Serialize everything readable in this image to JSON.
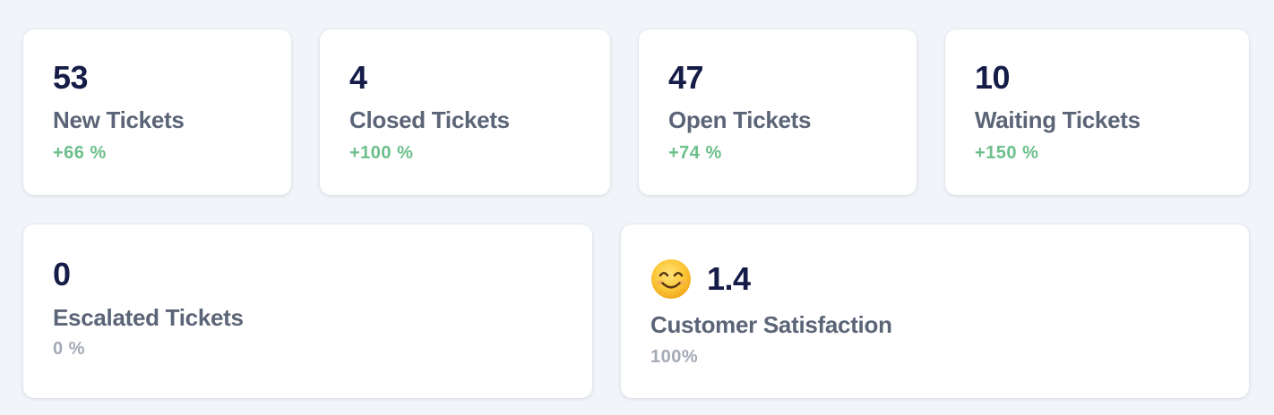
{
  "colors": {
    "background": "#f1f4f8",
    "card": "#ffffff",
    "value_text": "#141c47",
    "label_text": "#5b6577",
    "positive_change": "#6cbf8a",
    "neutral_change": "#a3aab6"
  },
  "stats": {
    "new": {
      "value": "53",
      "label": "New Tickets",
      "change": "+66 %"
    },
    "closed": {
      "value": "4",
      "label": "Closed Tickets",
      "change": "+100 %"
    },
    "open": {
      "value": "47",
      "label": "Open Tickets",
      "change": "+74 %"
    },
    "waiting": {
      "value": "10",
      "label": "Waiting Tickets",
      "change": "+150 %"
    },
    "escalated": {
      "value": "0",
      "label": "Escalated Tickets",
      "change": "0 %"
    },
    "csat": {
      "icon": "smiling-face-icon",
      "value": "1.4",
      "label": "Customer Satisfaction",
      "change": "100%"
    }
  }
}
